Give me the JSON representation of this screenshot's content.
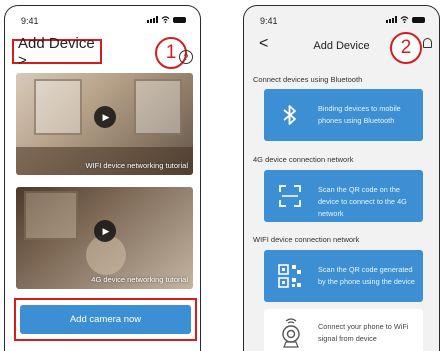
{
  "phone1": {
    "status": {
      "time": "9:41"
    },
    "title": "Add Device >",
    "badge": "1",
    "help_icon": "?",
    "videos": [
      {
        "caption": "WIFI device networking tutorial"
      },
      {
        "caption": "4G device networking tutorial"
      }
    ],
    "add_button": "Add camera now"
  },
  "phone2": {
    "status": {
      "time": "9:41"
    },
    "back": "<",
    "title": "Add Device",
    "badge": "2",
    "sections": [
      {
        "heading": "Connect devices using Bluetooth",
        "card": "Binding devices to mobile phones using Bluetooth",
        "icon": "bluetooth-icon"
      },
      {
        "heading": "4G device connection network",
        "card": "Scan the QR code on the device to connect to the 4G network",
        "icon": "scan-icon"
      },
      {
        "heading": "WIFI device connection network",
        "card": "Scan the QR code generated by the phone using the device",
        "icon": "qr-code-icon"
      }
    ],
    "wifi_card": "Connect your phone to WiFi signal from device",
    "colors": {
      "accent": "#3d8fd4",
      "highlight": "#d61d1d"
    }
  }
}
